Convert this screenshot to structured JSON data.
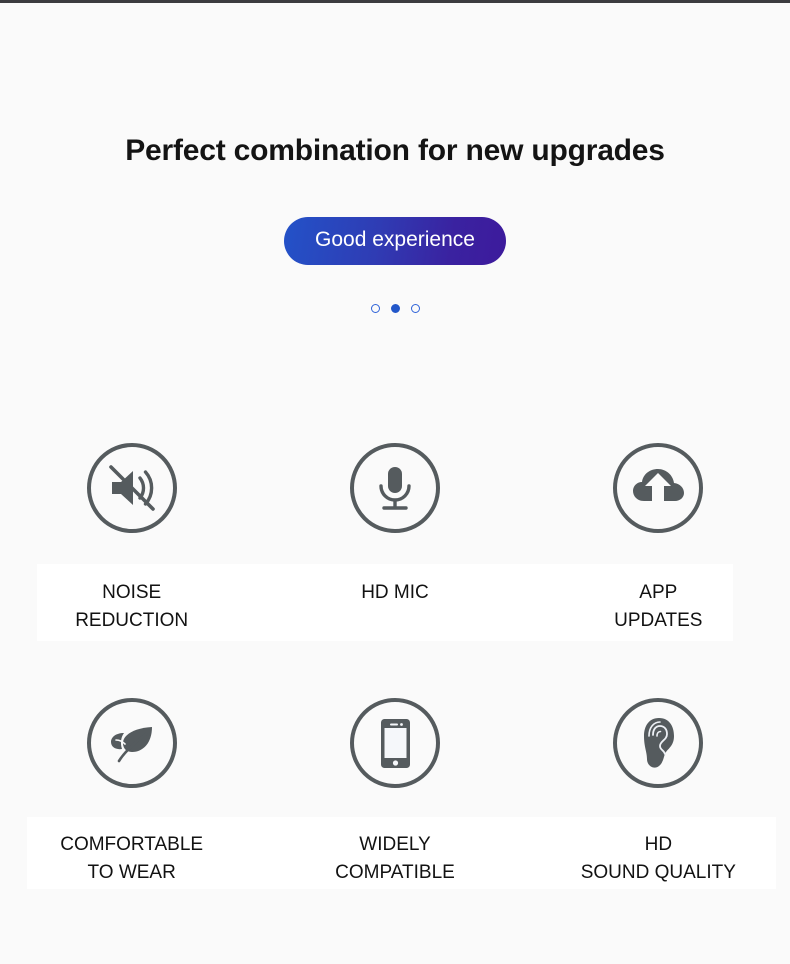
{
  "hero": {
    "title": "Perfect combination for new upgrades",
    "cta_label": "Good experience",
    "cta_gradient_start": "#2352c8",
    "cta_gradient_end": "#3d1a9c",
    "cta_text_color": "#ffffff"
  },
  "carousel": {
    "dot_color": "#2357c9",
    "dots": [
      {
        "name": "dot-1",
        "active": false
      },
      {
        "name": "dot-2",
        "active": true
      },
      {
        "name": "dot-3",
        "active": false
      }
    ]
  },
  "features": {
    "icon_stroke_color": "#555b5e",
    "row1": [
      {
        "icon": "mute-speaker-icon",
        "label": "NOISE\nREDUCTION"
      },
      {
        "icon": "microphone-icon",
        "label": "HD MIC"
      },
      {
        "icon": "cloud-upload-icon",
        "label": "APP\nUPDATES"
      }
    ],
    "row2": [
      {
        "icon": "leaf-icon",
        "label": "COMFORTABLE\nTO WEAR"
      },
      {
        "icon": "smartphone-icon",
        "label": "WIDELY\nCOMPATIBLE"
      },
      {
        "icon": "ear-icon",
        "label": "HD\nSOUND QUALITY"
      }
    ]
  }
}
